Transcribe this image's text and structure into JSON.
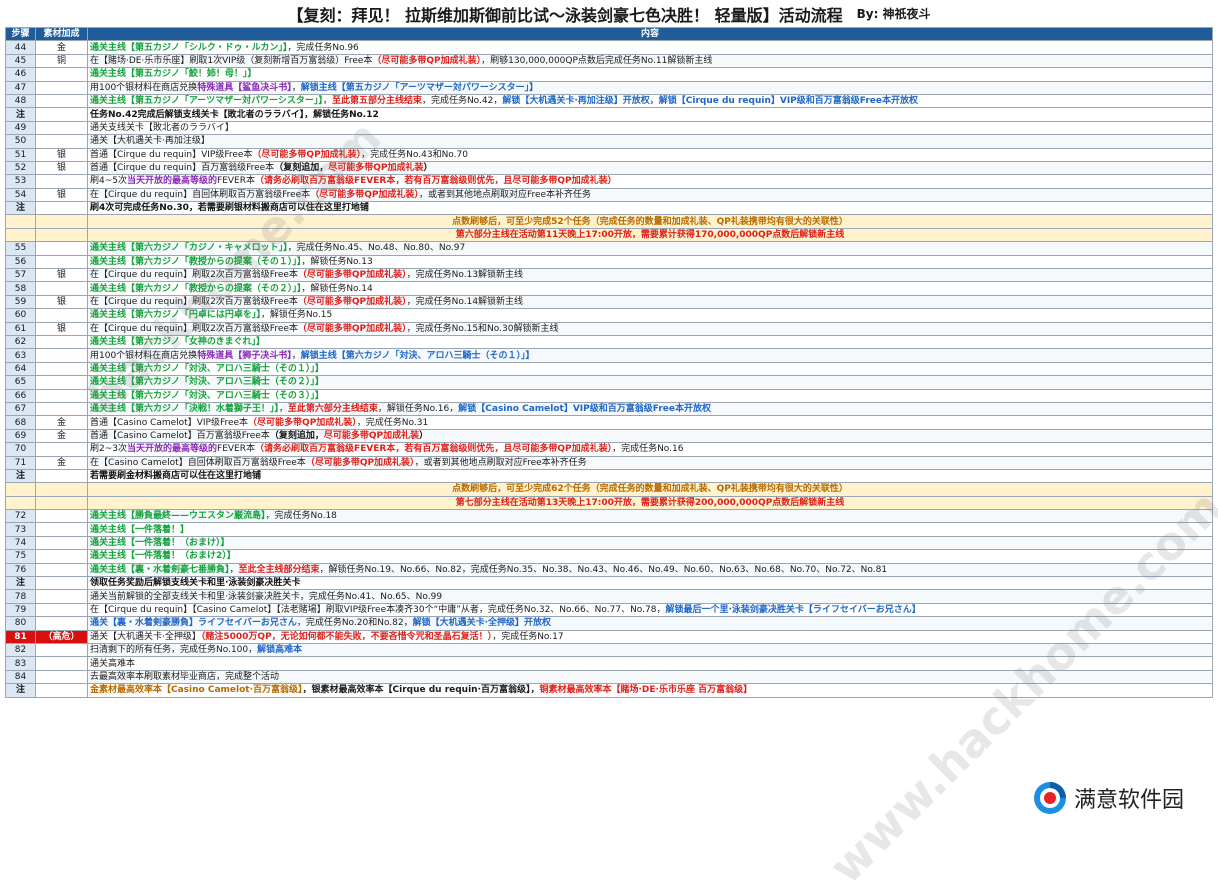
{
  "header": {
    "title": "【复刻：拜见！ 拉斯维加斯御前比试～泳装剑豪七色决胜！ 轻量版】活动流程",
    "by": "By:  神祇夜斗"
  },
  "columns": {
    "step": "步骤",
    "material": "素材加成",
    "content": "内容"
  },
  "rows": [
    {
      "type": "row",
      "step": "44",
      "mat": "金",
      "parts": [
        {
          "c": "g",
          "t": "通关主线【第五カジノ「シルク・ドゥ・ルカン」】"
        },
        {
          "c": "n",
          "t": "，完成任务No.96"
        }
      ]
    },
    {
      "type": "row",
      "step": "45",
      "mat": "铜",
      "parts": [
        {
          "c": "n",
          "t": "在【賭场·DE·乐市乐座】刷取1次VIP级（复刻新增百万富翁级）Free本"
        },
        {
          "c": "r",
          "t": "（尽可能多带QP加成礼装）"
        },
        {
          "c": "n",
          "t": "，刷够130,000,000QP点数后完成任务No.11解锁新主线"
        }
      ]
    },
    {
      "type": "row",
      "step": "46",
      "mat": "",
      "parts": [
        {
          "c": "g",
          "t": "通关主线【第五カジノ「鮫！姉！母！」】"
        }
      ]
    },
    {
      "type": "row",
      "step": "47",
      "mat": "",
      "parts": [
        {
          "c": "n",
          "t": "用100个银材料在商店兑换"
        },
        {
          "c": "p",
          "t": "特殊道具【鲨鱼决斗书】"
        },
        {
          "c": "n",
          "t": "，"
        },
        {
          "c": "b",
          "t": "解锁主线【第五カジノ「アーツマザー対パワーシスター」】"
        }
      ]
    },
    {
      "type": "row",
      "step": "48",
      "mat": "",
      "parts": [
        {
          "c": "g",
          "t": "通关主线【第五カジノ「アーツマザー対パワーシスター」】"
        },
        {
          "c": "n",
          "t": "，"
        },
        {
          "c": "r",
          "t": "至此第五部分主线结束"
        },
        {
          "c": "n",
          "t": "，完成任务No.42，"
        },
        {
          "c": "b",
          "t": "解锁【大机遇关卡·再加注级】开放权，解锁【Cirque du requin】VIP级和百万富翁级Free本开放权"
        }
      ]
    },
    {
      "type": "note",
      "step": "注",
      "mat": "",
      "parts": [
        {
          "c": "k",
          "t": "任务No.42完成后解锁支线关卡【敗北者のララバイ】，解锁任务No.12"
        }
      ]
    },
    {
      "type": "row",
      "step": "49",
      "mat": "",
      "parts": [
        {
          "c": "n",
          "t": "通关支线关卡【敗北者のララバイ】"
        }
      ]
    },
    {
      "type": "row",
      "step": "50",
      "mat": "",
      "parts": [
        {
          "c": "n",
          "t": "通关【大机遇关卡·再加注级】"
        }
      ]
    },
    {
      "type": "row",
      "step": "51",
      "mat": "银",
      "parts": [
        {
          "c": "n",
          "t": "首通【Cirque du requin】VIP级Free本"
        },
        {
          "c": "r",
          "t": "（尽可能多带QP加成礼装）"
        },
        {
          "c": "n",
          "t": "，完成任务No.43和No.70"
        }
      ]
    },
    {
      "type": "row",
      "step": "52",
      "mat": "银",
      "parts": [
        {
          "c": "n",
          "t": "首通【Cirque du requin】百万富翁级Free本"
        },
        {
          "c": "k",
          "t": "（复刻追加，"
        },
        {
          "c": "r",
          "t": "尽可能多带QP加成礼装"
        },
        {
          "c": "k",
          "t": "）"
        }
      ]
    },
    {
      "type": "row",
      "step": "53",
      "mat": "",
      "parts": [
        {
          "c": "n",
          "t": "刷4~5次"
        },
        {
          "c": "p",
          "t": "当天开放的最高等级的"
        },
        {
          "c": "n",
          "t": "FEVER本"
        },
        {
          "c": "r",
          "t": "（请务必刷取百万富翁级FEVER本，若有百万富翁级则优先，且尽可能多带QP加成礼装）"
        }
      ]
    },
    {
      "type": "row",
      "step": "54",
      "mat": "银",
      "parts": [
        {
          "c": "n",
          "t": "在【Cirque du requin】自回体刷取百万富翁级Free本"
        },
        {
          "c": "r",
          "t": "（尽可能多带QP加成礼装）"
        },
        {
          "c": "n",
          "t": "，或者到其他地点刷取对应Free本补齐任务"
        }
      ]
    },
    {
      "type": "note",
      "step": "注",
      "mat": "",
      "parts": [
        {
          "c": "k",
          "t": "刷4次可完成任务No.30，若需要刷银材料搬商店可以住在这里打地铺"
        }
      ]
    },
    {
      "type": "banner",
      "step": "",
      "mat": "",
      "parts": [
        {
          "c": "o",
          "t": "点数刷够后，可至少完成52个任务（完成任务的数量和加成礼装、QP礼装携带均有很大的关联性）"
        }
      ]
    },
    {
      "type": "banner",
      "step": "",
      "mat": "",
      "parts": [
        {
          "c": "r",
          "t": "第六部分主线在活动第11天晚上17:00开放，需要累计获得170,000,000QP点数后解锁新主线"
        }
      ]
    },
    {
      "type": "row",
      "step": "55",
      "mat": "",
      "parts": [
        {
          "c": "g",
          "t": "通关主线【第六カジノ「カジノ・キャメロット」】"
        },
        {
          "c": "n",
          "t": "，完成任务No.45、No.48、No.80、No.97"
        }
      ]
    },
    {
      "type": "row",
      "step": "56",
      "mat": "",
      "parts": [
        {
          "c": "g",
          "t": "通关主线【第六カジノ「教授からの提案（その１）」】"
        },
        {
          "c": "n",
          "t": "，解锁任务No.13"
        }
      ]
    },
    {
      "type": "row",
      "step": "57",
      "mat": "银",
      "parts": [
        {
          "c": "n",
          "t": "在【Cirque du requin】刷取2次百万富翁级Free本"
        },
        {
          "c": "r",
          "t": "（尽可能多带QP加成礼装）"
        },
        {
          "c": "n",
          "t": "，完成任务No.13解锁新主线"
        }
      ]
    },
    {
      "type": "row",
      "step": "58",
      "mat": "",
      "parts": [
        {
          "c": "g",
          "t": "通关主线【第六カジノ「教授からの提案（その２）」】"
        },
        {
          "c": "n",
          "t": "，解锁任务No.14"
        }
      ]
    },
    {
      "type": "row",
      "step": "59",
      "mat": "银",
      "parts": [
        {
          "c": "n",
          "t": "在【Cirque du requin】刷取2次百万富翁级Free本"
        },
        {
          "c": "r",
          "t": "（尽可能多带QP加成礼装）"
        },
        {
          "c": "n",
          "t": "，完成任务No.14解锁新主线"
        }
      ]
    },
    {
      "type": "row",
      "step": "60",
      "mat": "",
      "parts": [
        {
          "c": "g",
          "t": "通关主线【第六カジノ「円卓には円卓を」】"
        },
        {
          "c": "n",
          "t": "，解锁任务No.15"
        }
      ]
    },
    {
      "type": "row",
      "step": "61",
      "mat": "银",
      "parts": [
        {
          "c": "n",
          "t": "在【Cirque du requin】刷取2次百万富翁级Free本"
        },
        {
          "c": "r",
          "t": "（尽可能多带QP加成礼装）"
        },
        {
          "c": "n",
          "t": "，完成任务No.15和No.30解锁新主线"
        }
      ]
    },
    {
      "type": "row",
      "step": "62",
      "mat": "",
      "parts": [
        {
          "c": "g",
          "t": "通关主线【第六カジノ「女神のきまぐれ」】"
        }
      ]
    },
    {
      "type": "row",
      "step": "63",
      "mat": "",
      "parts": [
        {
          "c": "n",
          "t": "用100个银材料在商店兑换"
        },
        {
          "c": "p",
          "t": "特殊道具【狮子决斗书】"
        },
        {
          "c": "n",
          "t": "，"
        },
        {
          "c": "b",
          "t": "解锁主线【第六カジノ「対決、アロハ三騎士（その１）」】"
        }
      ]
    },
    {
      "type": "row",
      "step": "64",
      "mat": "",
      "parts": [
        {
          "c": "g",
          "t": "通关主线【第六カジノ「対決、アロハ三騎士（その１）」】"
        }
      ]
    },
    {
      "type": "row",
      "step": "65",
      "mat": "",
      "parts": [
        {
          "c": "g",
          "t": "通关主线【第六カジノ「対決、アロハ三騎士（その２）」】"
        }
      ]
    },
    {
      "type": "row",
      "step": "66",
      "mat": "",
      "parts": [
        {
          "c": "g",
          "t": "通关主线【第六カジノ「対決、アロハ三騎士（その３）」】"
        }
      ]
    },
    {
      "type": "row",
      "step": "67",
      "mat": "",
      "parts": [
        {
          "c": "g",
          "t": "通关主线【第六カジノ「決戦！水着獅子王！」】"
        },
        {
          "c": "n",
          "t": "，"
        },
        {
          "c": "r",
          "t": "至此第六部分主线结束"
        },
        {
          "c": "n",
          "t": "，解锁任务No.16，"
        },
        {
          "c": "b",
          "t": "解锁【Casino Camelot】VIP级和百万富翁级Free本开放权"
        }
      ]
    },
    {
      "type": "row",
      "step": "68",
      "mat": "金",
      "parts": [
        {
          "c": "n",
          "t": "首通【Casino Camelot】VIP级Free本"
        },
        {
          "c": "r",
          "t": "（尽可能多带QP加成礼装）"
        },
        {
          "c": "n",
          "t": "，完成任务No.31"
        }
      ]
    },
    {
      "type": "row",
      "step": "69",
      "mat": "金",
      "parts": [
        {
          "c": "n",
          "t": "首通【Casino Camelot】百万富翁级Free本"
        },
        {
          "c": "k",
          "t": "（复刻追加，"
        },
        {
          "c": "r",
          "t": "尽可能多带QP加成礼装"
        },
        {
          "c": "k",
          "t": "）"
        }
      ]
    },
    {
      "type": "row",
      "step": "70",
      "mat": "",
      "parts": [
        {
          "c": "n",
          "t": "刷2~3次"
        },
        {
          "c": "p",
          "t": "当天开放的最高等级的"
        },
        {
          "c": "n",
          "t": "FEVER本"
        },
        {
          "c": "r",
          "t": "（请务必刷取百万富翁级FEVER本，若有百万富翁级则优先，且尽可能多带QP加成礼装）"
        },
        {
          "c": "n",
          "t": "，完成任务No.16"
        }
      ]
    },
    {
      "type": "row",
      "step": "71",
      "mat": "金",
      "parts": [
        {
          "c": "n",
          "t": "在【Casino Camelot】自回体刷取百万富翁级Free本"
        },
        {
          "c": "r",
          "t": "（尽可能多带QP加成礼装）"
        },
        {
          "c": "n",
          "t": "，或者到其他地点刷取对应Free本补齐任务"
        }
      ]
    },
    {
      "type": "note",
      "step": "注",
      "mat": "",
      "parts": [
        {
          "c": "k",
          "t": "若需要刷金材料搬商店可以住在这里打地铺"
        }
      ]
    },
    {
      "type": "banner",
      "step": "",
      "mat": "",
      "parts": [
        {
          "c": "o",
          "t": "点数刷够后，可至少完成62个任务（完成任务的数量和加成礼装、QP礼装携带均有很大的关联性）"
        }
      ]
    },
    {
      "type": "banner",
      "step": "",
      "mat": "",
      "parts": [
        {
          "c": "r",
          "t": "第七部分主线在活动第13天晚上17:00开放，需要累计获得200,000,000QP点数后解锁新主线"
        }
      ]
    },
    {
      "type": "row",
      "step": "72",
      "mat": "",
      "parts": [
        {
          "c": "g",
          "t": "通关主线【勝負最終——ウエスタン巌流島】"
        },
        {
          "c": "n",
          "t": "，完成任务No.18"
        }
      ]
    },
    {
      "type": "row",
      "step": "73",
      "mat": "",
      "parts": [
        {
          "c": "g",
          "t": "通关主线【一件落着！】"
        }
      ]
    },
    {
      "type": "row",
      "step": "74",
      "mat": "",
      "parts": [
        {
          "c": "g",
          "t": "通关主线【一件落着！（おまけ）】"
        }
      ]
    },
    {
      "type": "row",
      "step": "75",
      "mat": "",
      "parts": [
        {
          "c": "g",
          "t": "通关主线【一件落着！（おまけ2）】"
        }
      ]
    },
    {
      "type": "row",
      "step": "76",
      "mat": "",
      "parts": [
        {
          "c": "g",
          "t": "通关主线【裏・水着剣豪七番勝負】"
        },
        {
          "c": "n",
          "t": "，"
        },
        {
          "c": "r",
          "t": "至此全主线部分结束"
        },
        {
          "c": "n",
          "t": "，解锁任务No.19、No.66、No.82，完成任务No.35、No.38、No.43、No.46、No.49、No.60、No.63、No.68、No.70、No.72、No.81"
        }
      ]
    },
    {
      "type": "note",
      "step": "注",
      "mat": "",
      "parts": [
        {
          "c": "k",
          "t": "领取任务奖励后解锁支线关卡和里·泳装剑豪决胜关卡"
        }
      ]
    },
    {
      "type": "row",
      "step": "78",
      "mat": "",
      "parts": [
        {
          "c": "n",
          "t": "通关当前解锁的全部支线关卡和里·泳装剑豪决胜关卡，完成任务No.41、No.65、No.99"
        }
      ]
    },
    {
      "type": "row",
      "step": "79",
      "mat": "",
      "parts": [
        {
          "c": "n",
          "t": "在【Cirque du requin】【Casino Camelot】【法老賭場】刷取VIP级Free本凑齐30个“中庸”从者，完成任务No.32、No.66、No.77、No.78，"
        },
        {
          "c": "b",
          "t": "解锁最后一个里·泳装剑豪决胜关卡【ライフセイバーお兄さん】"
        }
      ]
    },
    {
      "type": "row",
      "step": "80",
      "mat": "",
      "parts": [
        {
          "c": "b",
          "t": "通关【裏・水着剣豪勝負】ライフセイバーお兄さん"
        },
        {
          "c": "n",
          "t": "，完成任务No.20和No.82，"
        },
        {
          "c": "b",
          "t": "解锁【大机遇关卡·全押级】开放权"
        }
      ]
    },
    {
      "type": "danger",
      "step": "81",
      "mat": "（高危）",
      "parts": [
        {
          "c": "n",
          "t": "通关【大机遇关卡·全押级】"
        },
        {
          "c": "r",
          "t": "（赌注5000万QP，无论如何都不能失败，不要吝惜令咒和圣晶石复活！）"
        },
        {
          "c": "n",
          "t": "，完成任务No.17"
        }
      ]
    },
    {
      "type": "row",
      "step": "82",
      "mat": "",
      "parts": [
        {
          "c": "n",
          "t": "扫清剩下的所有任务，完成任务No.100，"
        },
        {
          "c": "b",
          "t": "解锁高难本"
        }
      ]
    },
    {
      "type": "row",
      "step": "83",
      "mat": "",
      "parts": [
        {
          "c": "n",
          "t": "通关高难本"
        }
      ]
    },
    {
      "type": "row",
      "step": "84",
      "mat": "",
      "parts": [
        {
          "c": "n",
          "t": "去最高效率本刷取素材毕业商店，完成整个活动"
        }
      ]
    },
    {
      "type": "note",
      "step": "注",
      "mat": "",
      "parts": [
        {
          "c": "o",
          "t": "金素材最高效率本【Casino Camelot·百万富翁级】"
        },
        {
          "c": "n",
          "t": "，银素材最高效率本【Cirque du requin·百万富翁级】，"
        },
        {
          "c": "r",
          "t": "铜素材最高效率本【賭场·DE·乐市乐座 百万富翁级】"
        }
      ]
    }
  ],
  "watermarks": [
    "hackhome.com",
    "www.hackhome.com"
  ],
  "logo": {
    "text": "满意软件园",
    "icon": "logo-swirl-icon"
  },
  "colors": {
    "header_bg": "#1f5c99",
    "green": "#13a23b",
    "red": "#e0201a",
    "blue": "#1e66c8",
    "orange": "#b86a00",
    "purple": "#8a2ab8",
    "danger_bg": "#d80f0f"
  }
}
